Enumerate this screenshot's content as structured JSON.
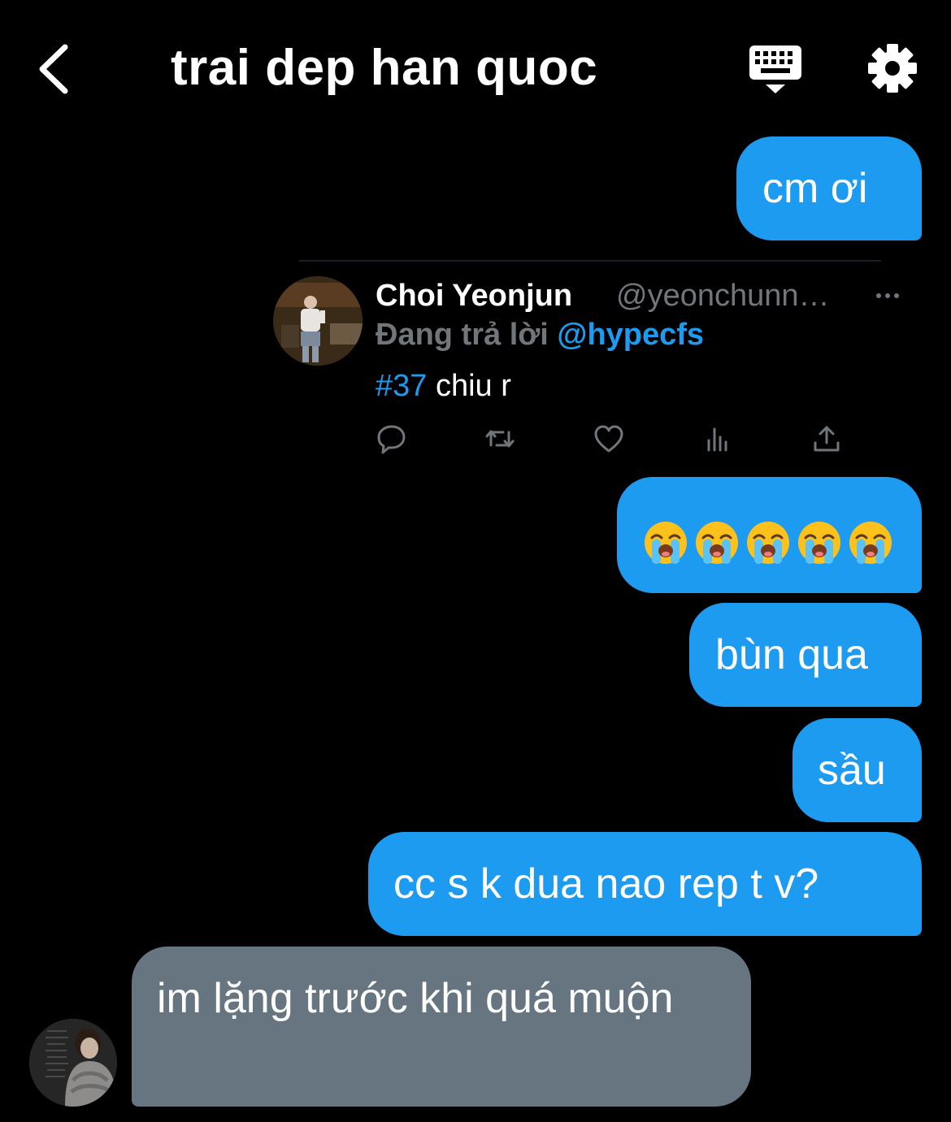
{
  "header": {
    "title": "trai dep han quoc",
    "back_icon": "chevron-left-icon",
    "keyboard_icon": "keyboard-icon",
    "settings_icon": "gear-icon"
  },
  "messages": [
    {
      "direction": "out",
      "text": "cm ơi"
    },
    {
      "direction": "out",
      "type": "emoji",
      "emoji": "loudly-crying-face",
      "count": 5
    },
    {
      "direction": "out",
      "text": "bùn qua"
    },
    {
      "direction": "out",
      "text": "sầu"
    },
    {
      "direction": "out",
      "text": "cc s k dua nao rep t v?"
    },
    {
      "direction": "in",
      "text": "im lặng trước khi quá muộn"
    }
  ],
  "tweet": {
    "name": "Choi Yeonjun",
    "handle": "@yeonchunn…",
    "reply_prefix": "Đang trả lời",
    "reply_mention": "@hypecfs",
    "hashtag": "#37",
    "text": " chiu r",
    "actions": [
      "reply-icon",
      "retweet-icon",
      "like-icon",
      "analytics-icon",
      "share-icon"
    ]
  },
  "colors": {
    "background": "#000000",
    "outgoing_bubble": "#1d9bf0",
    "incoming_bubble": "#66757f",
    "link": "#1d9bf0",
    "muted_text": "#71767b"
  }
}
